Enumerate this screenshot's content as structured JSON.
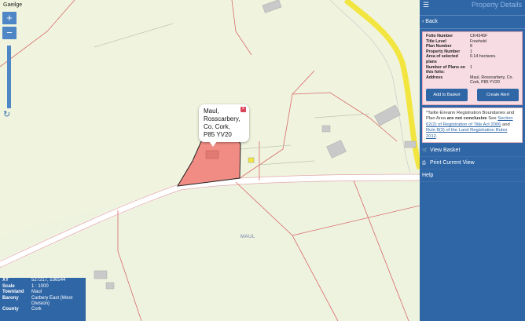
{
  "map": {
    "language_link": "Gaeilge",
    "zoom_in": "+",
    "zoom_out": "−",
    "refresh_icon": "↻",
    "popup": {
      "lines": [
        "Maul,",
        "Rosscarbery,",
        "Co. Cork,",
        "P85 YV20"
      ],
      "close": "×"
    },
    "townland_label": "MAUL",
    "info": [
      {
        "key": "XY",
        "value": "527217, 536544"
      },
      {
        "key": "Scale",
        "value": "1 : 1000"
      },
      {
        "key": "Townland",
        "value": "Maul"
      },
      {
        "key": "Barony",
        "value": "Carbery East (West Division)"
      },
      {
        "key": "County",
        "value": "Cork"
      }
    ]
  },
  "panel": {
    "menu_icon": "☰",
    "title": "Property Details",
    "back": "Back",
    "details": [
      {
        "key": "Folio Number",
        "value": "CK4345F"
      },
      {
        "key": "Title Level",
        "value": "Freehold"
      },
      {
        "key": "Plan Number",
        "value": "8"
      },
      {
        "key": "Property Number",
        "value": "1"
      },
      {
        "key": "Area of selected plans",
        "value": "0.14 hectares."
      },
      {
        "key": "Number of Plans on this folio:",
        "value": "1"
      },
      {
        "key": "Address",
        "value": "Maul, Rosscarbery, Co. Cork, P85 YV20"
      }
    ],
    "add_to_basket": "Add to Basket",
    "create_alert": "Create Alert",
    "notice": {
      "prefix": "*Tailte Éireann Registration Boundaries and Plan Area ",
      "bold": "are not conclusive",
      "mid1": " See ",
      "link1": "Section 62(2) of Registration of Title Act 2006",
      "mid2": " and ",
      "link2": "Rule 8(3) of the Land Registration Rules 2012",
      "suffix": "."
    },
    "view_basket": "View Basket",
    "print_current_view": "Print Current View",
    "help": "Help"
  },
  "colors": {
    "panel_blue": "#2f66a6",
    "parcel_fill": "#f08c83",
    "road_yellow": "#f3e53f",
    "boundary_red": "#d86a6a"
  }
}
